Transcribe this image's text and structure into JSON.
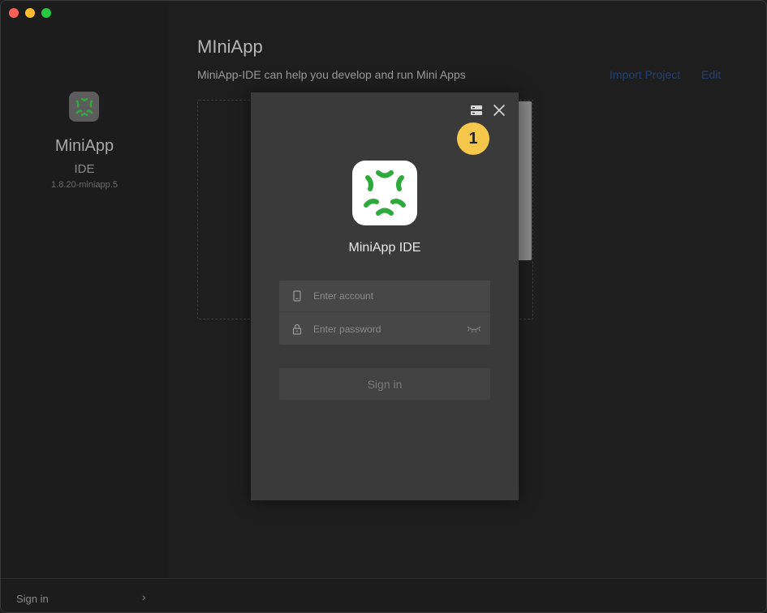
{
  "window": {
    "controls": [
      "close",
      "minimize",
      "maximize"
    ]
  },
  "sidebar": {
    "logo_icon": "miniapp-logo-icon",
    "app_name": "MiniApp",
    "app_sub": "IDE",
    "version": "1.8.20-miniapp.5",
    "footer": {
      "signin_label": "Sign in",
      "chevron": "›"
    }
  },
  "main": {
    "title": "MIniApp",
    "subtitle": "MiniApp-IDE can help you develop and run Mini Apps",
    "links": {
      "import_project": "Import Project",
      "edit": "Edit"
    }
  },
  "modal": {
    "server_icon": "server-icon",
    "close_icon": "close-icon",
    "badge": "1",
    "app_name": "MiniApp IDE",
    "account": {
      "value": "",
      "placeholder": "Enter account"
    },
    "password": {
      "value": "",
      "placeholder": "Enter password"
    },
    "signin_label": "Sign in"
  },
  "colors": {
    "logo_green": "#2eaa3c",
    "badge": "#f5c84b",
    "link": "#24406b"
  }
}
